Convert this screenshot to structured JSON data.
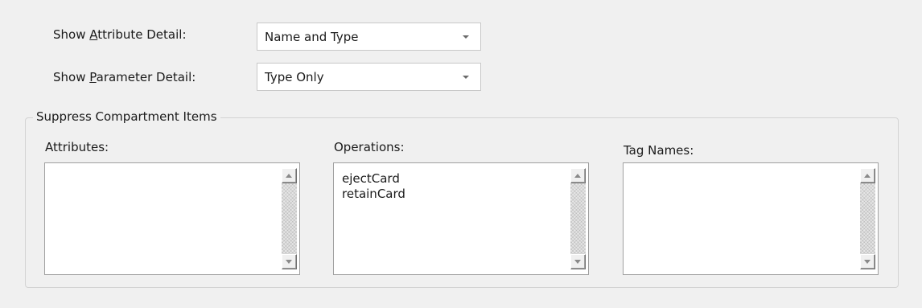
{
  "attribute_detail": {
    "label_pre": "Show ",
    "label_accel": "A",
    "label_post": "ttribute Detail:",
    "value": "Name and Type",
    "icon": "chevron-down-icon"
  },
  "parameter_detail": {
    "label_pre": "Show ",
    "label_accel": "P",
    "label_post": "arameter Detail:",
    "value": "Type Only",
    "icon": "chevron-down-icon"
  },
  "suppress_group": {
    "title": "Suppress Compartment Items",
    "attributes": {
      "label": "Attributes:",
      "items": []
    },
    "operations": {
      "label": "Operations:",
      "items": [
        "ejectCard",
        "retainCard"
      ]
    },
    "tag_names": {
      "label": "Tag Names:",
      "items": []
    },
    "scroll_icons": [
      "scroll-up-icon",
      "scroll-down-icon"
    ]
  }
}
